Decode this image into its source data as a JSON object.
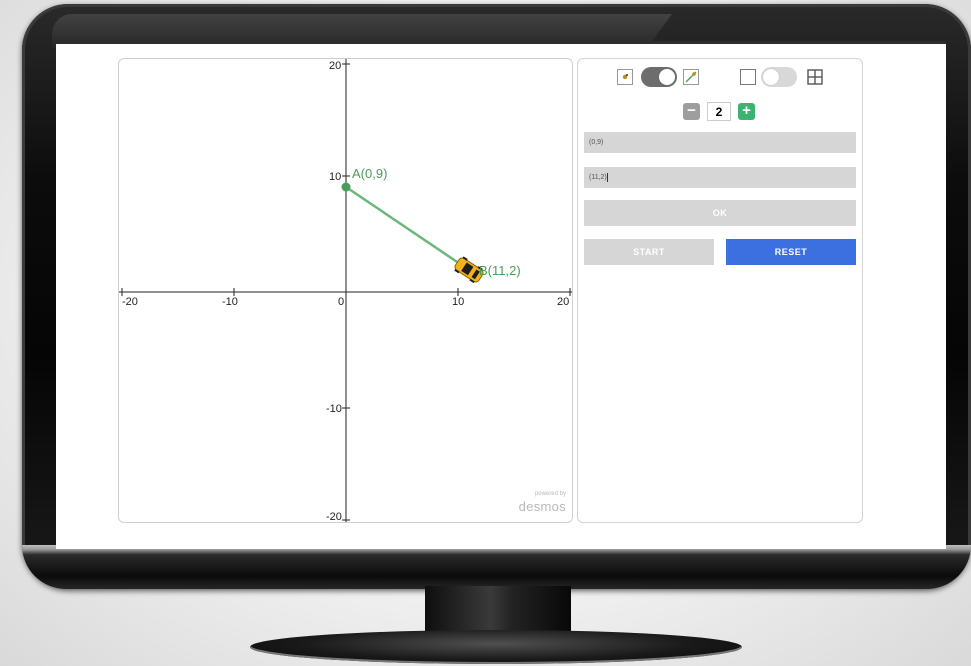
{
  "graph": {
    "x_ticks": [
      "-20",
      "-10",
      "0",
      "10",
      "20"
    ],
    "y_ticks": [
      "20",
      "10",
      "-10",
      "-20"
    ],
    "point_a": {
      "label": "A(0,9)",
      "x": 0,
      "y": 9
    },
    "point_b": {
      "label": "B(11,2)",
      "x": 11,
      "y": 2
    },
    "line_color": "#6bb77b",
    "car_color": "#f2b21c",
    "watermark": {
      "powered_by": "powered by",
      "brand": "desmos"
    }
  },
  "panel": {
    "mode_toggle": {
      "left_icon": "point-icon",
      "right_icon": "line-icon",
      "state": "right"
    },
    "grid_toggle": {
      "left_icon": "empty-square-icon",
      "right_icon": "grid-icon",
      "state": "left"
    },
    "stepper": {
      "value": "2",
      "minus_color": "#9e9e9e",
      "plus_color": "#3cb371"
    },
    "field_1": "(0,9)",
    "field_2": "(11,2)",
    "ok_label": "OK",
    "start_label": "START",
    "reset_label": "RESET",
    "reset_color": "#3c6fe0",
    "button_gray": "#d6d6d6"
  }
}
